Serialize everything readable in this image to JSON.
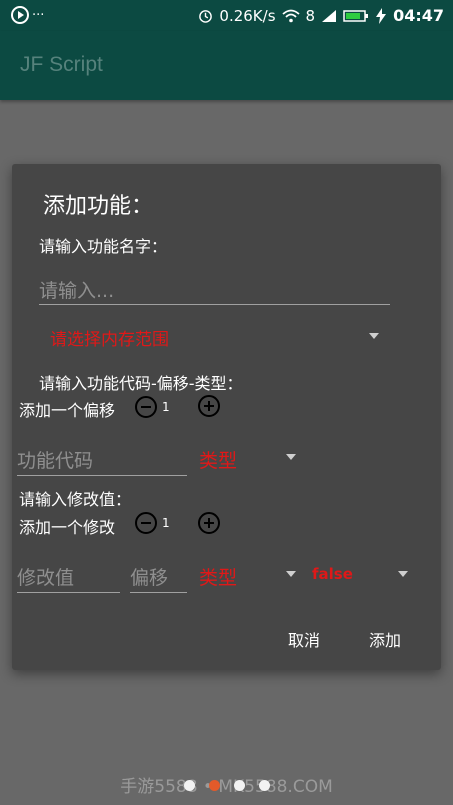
{
  "status_bar": {
    "notif_icon": "app-notification-icon",
    "ellipsis": "···",
    "speed": "0.26K/s",
    "battery_text": "8",
    "time": "04:47"
  },
  "app": {
    "title": "JF Script"
  },
  "dialog": {
    "title": "添加功能：",
    "name_label": "请输入功能名字：",
    "name_placeholder": "请输入...",
    "memory_range": "请选择内存范围",
    "code_label": "请输入功能代码-偏移-类型：",
    "add_offset_label": "添加一个偏移",
    "offset_count": "1",
    "code_placeholder": "功能代码",
    "code_type": "类型",
    "modify_label": "请输入修改值：",
    "add_modify_label": "添加一个修改",
    "modify_count": "1",
    "value_placeholder": "修改值",
    "offset_placeholder": "偏移",
    "value_type": "类型",
    "freeze": "false",
    "cancel": "取消",
    "add": "添加"
  },
  "watermark": "手游5588 • MK5588.COM",
  "colors": {
    "primary": "#0c4a42",
    "accent_red": "#e01818",
    "dialog_bg": "#464646"
  }
}
